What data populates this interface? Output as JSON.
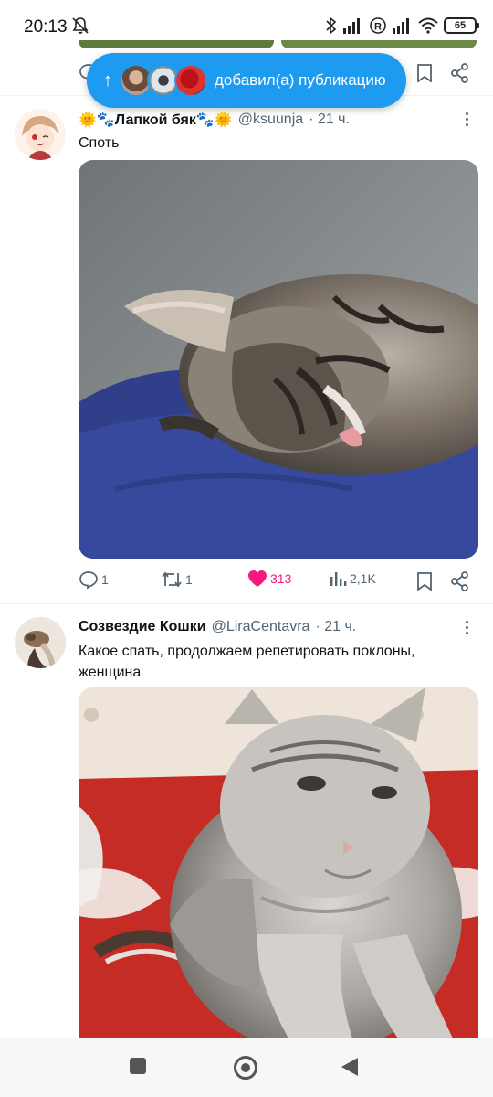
{
  "status_bar": {
    "time": "20:13",
    "battery": "65"
  },
  "new_posts_pill": {
    "label": "добавил(а) публикацию"
  },
  "tweets": [
    {
      "display_name": "🌞🐾Лапкой бяк🐾🌞",
      "handle": "@ksuunja",
      "time": "· 21 ч.",
      "text": "Споть",
      "media_alt": "sleeping-tabby-kitten-photo",
      "replies": "1",
      "retweets": "1",
      "likes": "313",
      "liked": true,
      "views": "2,1K"
    },
    {
      "display_name": "Созвездие Кошки",
      "handle": "@LiraCentavra",
      "time": "· 21 ч.",
      "text": "Какое спать, продолжаем репетировать поклоны, женщина",
      "media_alt": "silver-tabby-cat-on-red-blanket-photo"
    }
  ],
  "colors": {
    "accent": "#1d9bf0",
    "like": "#f91880",
    "secondary_text": "#536471"
  }
}
